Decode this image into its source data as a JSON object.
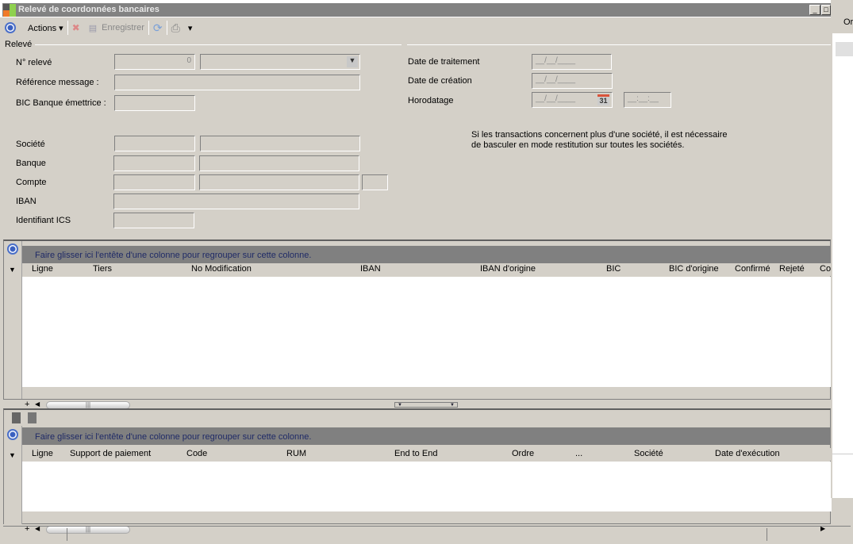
{
  "window": {
    "title": "Relevé de coordonnées bancaires"
  },
  "toolbar": {
    "actions": "Actions",
    "save": "Enregistrer"
  },
  "form": {
    "section": "Relevé",
    "n_releve": {
      "label": "N° relevé",
      "value": "0"
    },
    "reference": {
      "label": "Référence message :"
    },
    "bic": {
      "label": "BIC Banque émettrice :"
    },
    "societe": {
      "label": "Société"
    },
    "banque": {
      "label": "Banque"
    },
    "compte": {
      "label": "Compte"
    },
    "iban": {
      "label": "IBAN"
    },
    "ics": {
      "label": "Identifiant ICS"
    },
    "date_traitement": {
      "label": "Date de traitement",
      "placeholder": "__/__/____"
    },
    "date_creation": {
      "label": "Date de création",
      "placeholder": "__/__/____"
    },
    "horodatage": {
      "label": "Horodatage",
      "placeholder": "__/__/____",
      "time": "__:__:__",
      "cal": "31"
    },
    "note1": "Si les transactions concernent plus d'une société, il est nécessaire",
    "note2": "de basculer en mode restitution sur toutes les sociétés."
  },
  "grid1": {
    "group_hint": "Faire glisser ici l'entête d'une colonne pour regrouper sur cette colonne.",
    "columns": [
      "Ligne",
      "Tiers",
      "No Modification",
      "IBAN",
      "IBAN d'origine",
      "BIC",
      "BIC d'origine",
      "Confirmé",
      "Rejeté",
      "Co"
    ]
  },
  "grid2": {
    "group_hint": "Faire glisser ici l'entête d'une colonne pour regrouper sur cette colonne.",
    "columns": [
      "Ligne",
      "Support de paiement",
      "Code",
      "RUM",
      "End to End",
      "Ordre",
      "...",
      "Société",
      "Date d'exécution"
    ]
  },
  "side": {
    "label": "Or"
  }
}
